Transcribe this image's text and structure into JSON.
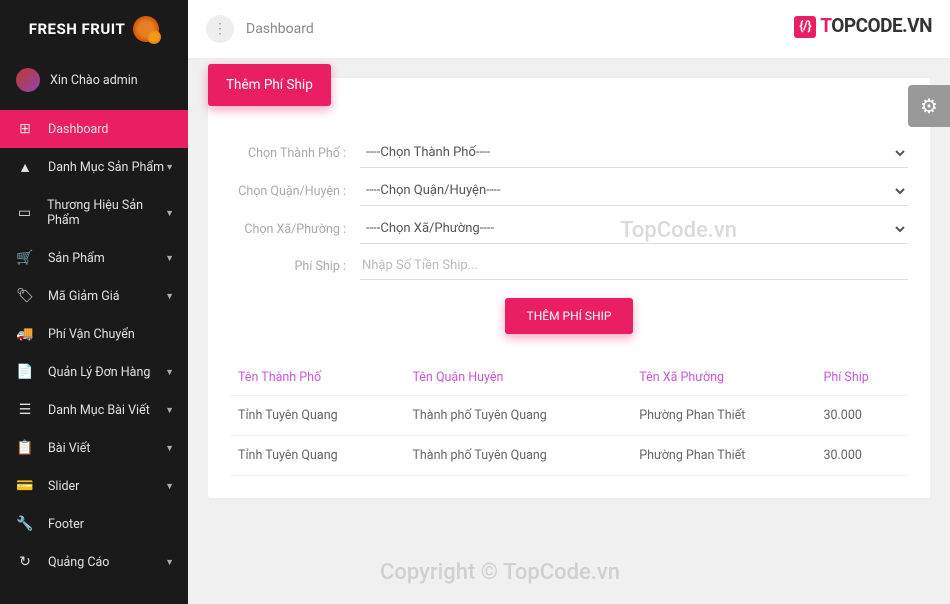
{
  "brand": "FRESH FRUIT",
  "greeting": "Xin Chào admin",
  "topbar": {
    "title": "Dashboard",
    "logo_text": "TOPCODE.VN"
  },
  "nav": [
    {
      "icon": "⊞",
      "label": "Dashboard",
      "active": true,
      "caret": false
    },
    {
      "icon": "▲",
      "label": "Danh Mục Sản Phẩm",
      "caret": true
    },
    {
      "icon": "▭",
      "label": "Thương Hiệu Sản Phẩm",
      "caret": true
    },
    {
      "icon": "🛒",
      "label": "Sản Phẩm",
      "caret": true
    },
    {
      "icon": "🏷",
      "label": "Mã Giảm Giá",
      "caret": true
    },
    {
      "icon": "🚚",
      "label": "Phí Vận Chuyển",
      "caret": false
    },
    {
      "icon": "📄",
      "label": "Quản Lý Đơn Hàng",
      "caret": true
    },
    {
      "icon": "☰",
      "label": "Danh Mục Bài Viết",
      "caret": true
    },
    {
      "icon": "📋",
      "label": "Bài Viết",
      "caret": true
    },
    {
      "icon": "💳",
      "label": "Slider",
      "caret": true
    },
    {
      "icon": "🔧",
      "label": "Footer",
      "caret": false
    },
    {
      "icon": "↻",
      "label": "Quảng Cáo",
      "caret": true
    }
  ],
  "card": {
    "title": "Thêm Phí Ship"
  },
  "form": {
    "rows": [
      {
        "label": "Chọn Thành Phố :",
        "opt": "----Chọn Thành Phố----",
        "type": "select"
      },
      {
        "label": "Chọn Quận/Huyện :",
        "opt": "----Chọn Quận/Huyện----",
        "type": "select"
      },
      {
        "label": "Chọn Xã/Phường :",
        "opt": "----Chọn Xã/Phường----",
        "type": "select"
      },
      {
        "label": "Phí Ship :",
        "ph": "Nhập Số Tiền Ship...",
        "type": "input"
      }
    ],
    "submit": "THÊM PHÍ SHIP"
  },
  "table": {
    "headers": [
      "Tên Thành Phố",
      "Tên Quận Huyện",
      "Tên Xã Phường",
      "Phí Ship"
    ],
    "rows": [
      [
        "Tỉnh Tuyên Quang",
        "Thành phố Tuyên Quang",
        "Phường Phan Thiết",
        "30.000"
      ],
      [
        "Tỉnh Tuyên Quang",
        "Thành phố Tuyên Quang",
        "Phường Phan Thiết",
        "30.000"
      ]
    ]
  },
  "watermarks": {
    "w1": "TopCode.vn",
    "w2": "Copyright © TopCode.vn"
  }
}
